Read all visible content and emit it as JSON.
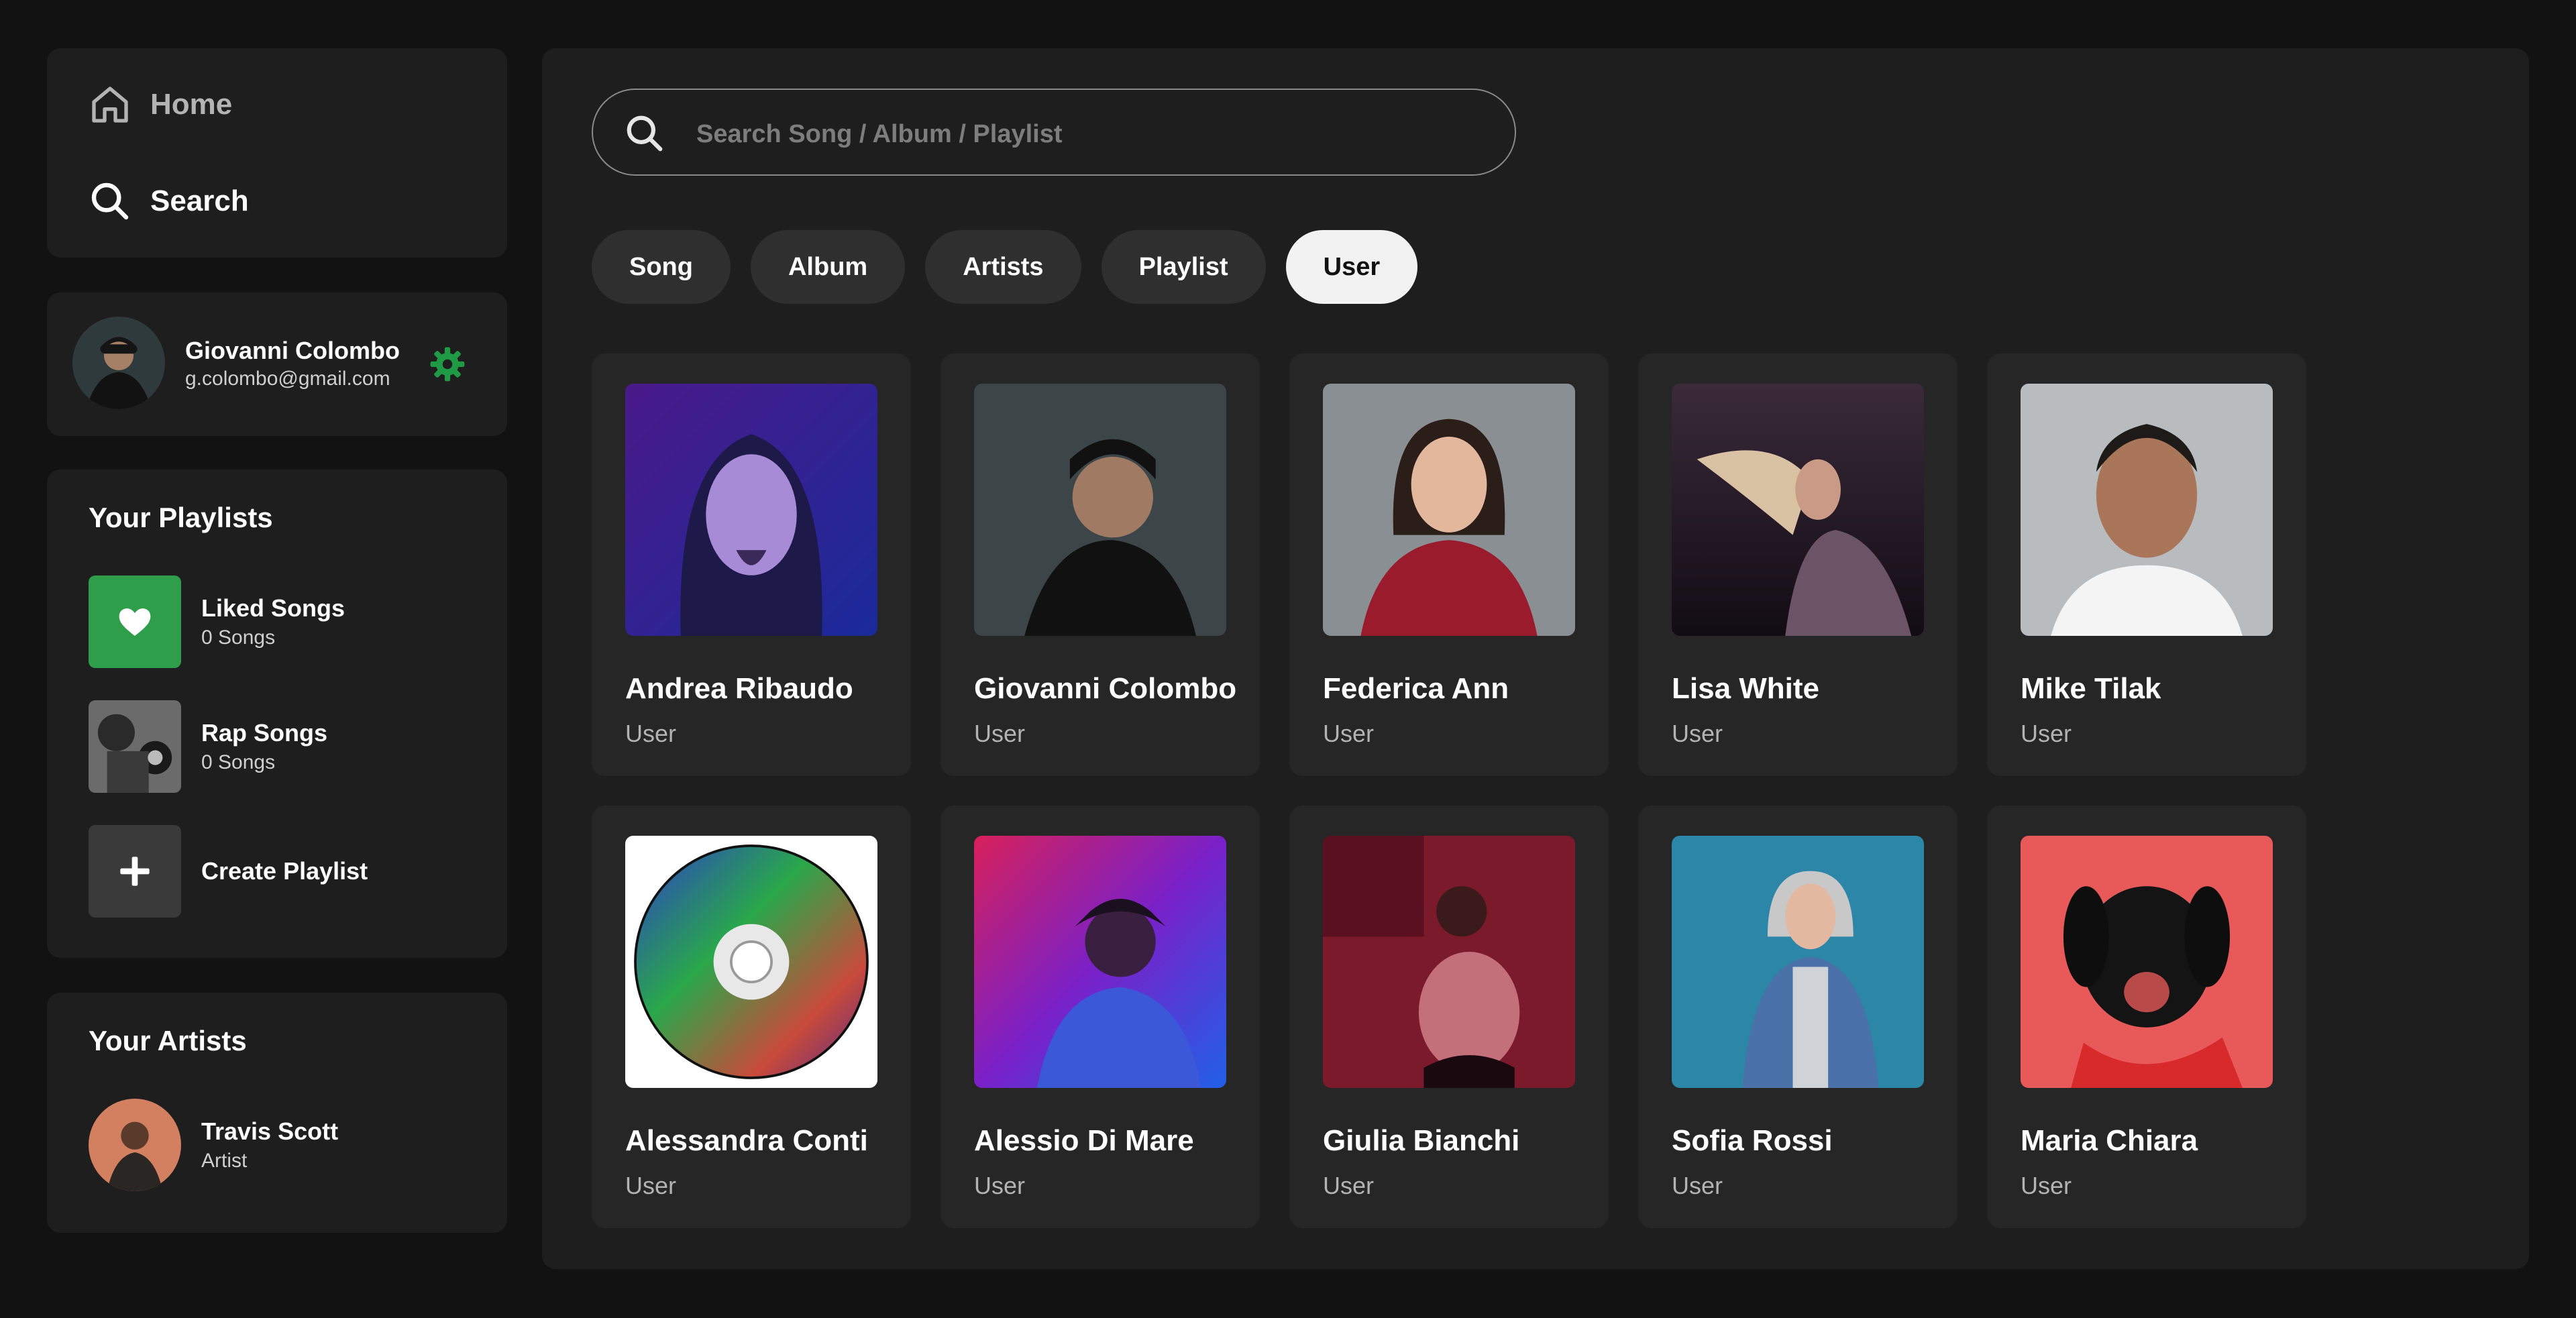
{
  "nav": {
    "home_label": "Home",
    "search_label": "Search"
  },
  "profile": {
    "name": "Giovanni Colombo",
    "email": "g.colombo@gmail.com"
  },
  "playlists": {
    "title": "Your Playlists",
    "items": [
      {
        "name": "Liked Songs",
        "sub": "0 Songs"
      },
      {
        "name": "Rap Songs",
        "sub": "0 Songs"
      },
      {
        "name": "Create Playlist"
      }
    ]
  },
  "artists": {
    "title": "Your Artists",
    "items": [
      {
        "name": "Travis Scott",
        "sub": "Artist"
      }
    ]
  },
  "search": {
    "placeholder": "Search Song / Album / Playlist",
    "value": ""
  },
  "filters": [
    "Song",
    "Album",
    "Artists",
    "Playlist",
    "User"
  ],
  "active_filter": "User",
  "results": [
    {
      "name": "Andrea Ribaudo",
      "sub": "User"
    },
    {
      "name": "Giovanni Colombo",
      "sub": "User"
    },
    {
      "name": "Federica Ann",
      "sub": "User"
    },
    {
      "name": "Lisa White",
      "sub": "User"
    },
    {
      "name": "Mike Tilak",
      "sub": "User"
    },
    {
      "name": "Alessandra Conti",
      "sub": "User"
    },
    {
      "name": "Alessio Di Mare",
      "sub": "User"
    },
    {
      "name": "Giulia Bianchi",
      "sub": "User"
    },
    {
      "name": "Sofia Rossi",
      "sub": "User"
    },
    {
      "name": "Maria Chiara",
      "sub": "User"
    }
  ],
  "colors": {
    "accent": "#1db954",
    "liked_bg": "#2e9e4a",
    "panel": "#1e1e1e",
    "card": "#262626"
  }
}
